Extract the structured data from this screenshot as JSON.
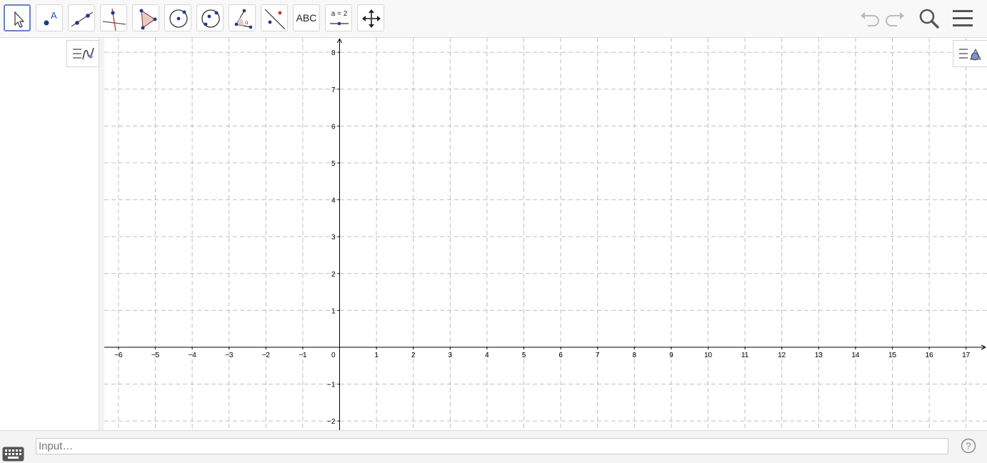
{
  "toolbar": {
    "tools": [
      {
        "name": "move-tool",
        "active": true
      },
      {
        "name": "point-tool"
      },
      {
        "name": "line-tool"
      },
      {
        "name": "perpendicular-line-tool"
      },
      {
        "name": "polygon-tool"
      },
      {
        "name": "circle-center-point-tool"
      },
      {
        "name": "circle-three-points-tool"
      },
      {
        "name": "angle-tool"
      },
      {
        "name": "reflect-tool"
      },
      {
        "name": "text-tool",
        "label": "ABC"
      },
      {
        "name": "slider-tool",
        "label": "a = 2"
      },
      {
        "name": "move-graphics-view-tool"
      }
    ],
    "right_buttons": [
      "undo-icon",
      "redo-icon",
      "search-icon",
      "menu-icon"
    ]
  },
  "graphics": {
    "x_ticks": [
      "−6",
      "−5",
      "−4",
      "−3",
      "−2",
      "−1",
      "1",
      "2",
      "3",
      "4",
      "5",
      "6",
      "7",
      "8",
      "9",
      "10",
      "11",
      "12",
      "13",
      "14",
      "15",
      "16",
      "17"
    ],
    "y_ticks": [
      "8",
      "7",
      "6",
      "5",
      "4",
      "3",
      "2",
      "1",
      "−1",
      "−2"
    ],
    "origin_label": "0",
    "colors": {
      "axis": "#000000",
      "grid": "#c0c0c0",
      "accent": "#6b82c9"
    }
  },
  "input_bar": {
    "placeholder": "Input…"
  }
}
